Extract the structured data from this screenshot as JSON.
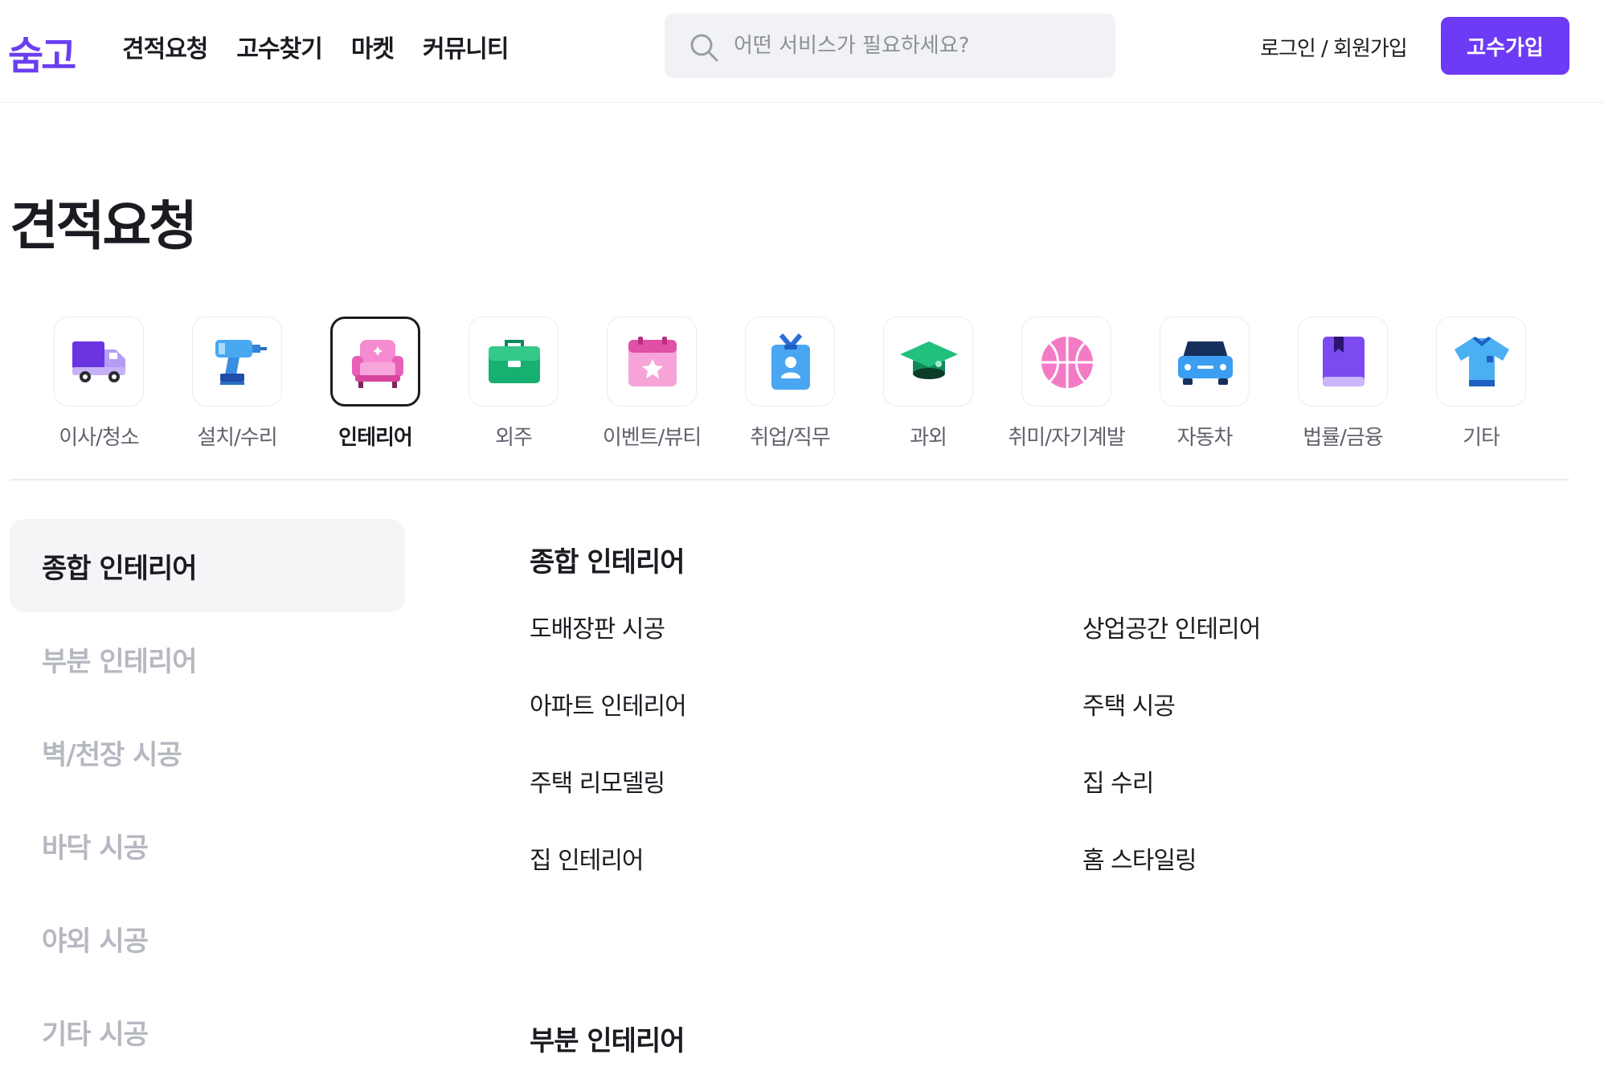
{
  "header": {
    "logo": "숨고",
    "nav": [
      "견적요청",
      "고수찾기",
      "마켓",
      "커뮤니티"
    ],
    "search_placeholder": "어떤 서비스가 필요하세요?",
    "login": "로그인 / 회원가입",
    "join_button": "고수가입"
  },
  "page_title": "견적요청",
  "categories": [
    {
      "label": "이사/청소",
      "icon": "truck-icon"
    },
    {
      "label": "설치/수리",
      "icon": "drill-icon"
    },
    {
      "label": "인테리어",
      "icon": "armchair-icon",
      "active": true
    },
    {
      "label": "외주",
      "icon": "briefcase-icon"
    },
    {
      "label": "이벤트/뷰티",
      "icon": "calendar-star-icon"
    },
    {
      "label": "취업/직무",
      "icon": "id-badge-icon"
    },
    {
      "label": "과외",
      "icon": "graduation-cap-icon"
    },
    {
      "label": "취미/자기계발",
      "icon": "basketball-icon"
    },
    {
      "label": "자동차",
      "icon": "car-icon"
    },
    {
      "label": "법률/금융",
      "icon": "book-icon"
    },
    {
      "label": "기타",
      "icon": "shirt-icon"
    }
  ],
  "sidebar": {
    "items": [
      "종합 인테리어",
      "부분 인테리어",
      "벽/천장 시공",
      "바닥 시공",
      "야외 시공",
      "기타 시공"
    ],
    "active_index": 0
  },
  "sections": [
    {
      "title": "종합 인테리어",
      "items": [
        "도배장판 시공",
        "상업공간 인테리어",
        "아파트 인테리어",
        "주택 시공",
        "주택 리모델링",
        "집 수리",
        "집 인테리어",
        "홈 스타일링"
      ]
    },
    {
      "title": "부분 인테리어"
    }
  ],
  "colors": {
    "brand": "#6d3af5",
    "text": "#1b1c21",
    "muted": "#b6b8c1"
  }
}
